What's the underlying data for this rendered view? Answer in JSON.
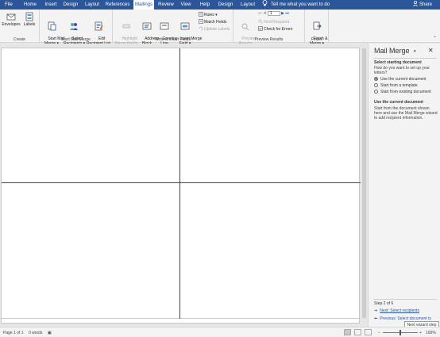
{
  "tabs": [
    {
      "label": "File"
    },
    {
      "label": "Home"
    },
    {
      "label": "Insert"
    },
    {
      "label": "Design"
    },
    {
      "label": "Layout"
    },
    {
      "label": "References"
    },
    {
      "label": "Mailings"
    },
    {
      "label": "Review"
    },
    {
      "label": "View"
    },
    {
      "label": "Help"
    },
    {
      "label": "Design"
    },
    {
      "label": "Layout"
    }
  ],
  "tell_me": "Tell me what you want to do",
  "share": "Share",
  "ribbon": {
    "create": {
      "label": "Create",
      "envelopes": "Envelopes",
      "labels": "Labels"
    },
    "start": {
      "label": "Start Mail Merge",
      "start_mail_merge": "Start Mail\nMerge ▾",
      "select_recipients": "Select\nRecipients ▾",
      "edit_recipient_list": "Edit\nRecipient List"
    },
    "write": {
      "label": "Write & Insert Fields",
      "highlight": "Highlight\nMerge Fields",
      "address_block": "Address\nBlock",
      "greeting_line": "Greeting\nLine",
      "insert_merge_field": "Insert Merge\nField ▾",
      "rules": "Rules ▾",
      "match_fields": "Match Fields",
      "update_labels": "Update Labels"
    },
    "preview": {
      "label": "Preview Results",
      "preview_results": "Preview\nResults",
      "record_value": "1",
      "find_recipient": "Find Recipient",
      "check_for_errors": "Check for Errors"
    },
    "finish": {
      "label": "Finish",
      "finish_merge": "Finish &\nMerge ▾"
    }
  },
  "pane": {
    "title": "Mail Merge",
    "section1_heading": "Select starting document",
    "section1_text": "How do you want to set up your letters?",
    "options": [
      "Use the current document",
      "Start from a template",
      "Start from existing document"
    ],
    "selected_option": "Use the current document",
    "section2_heading": "Use the current document",
    "section2_text": "Start from the document shown here and use the Mail Merge wizard to add recipient information.",
    "step": "Step 2 of 6",
    "next_link": "Next: Select recipients",
    "previous_link": "Previous: Select document ty",
    "tooltip": "Next wizard step"
  },
  "status": {
    "page": "Page 1 of 1",
    "words": "0 words",
    "zoom": "100%",
    "zoom_level": 100
  }
}
